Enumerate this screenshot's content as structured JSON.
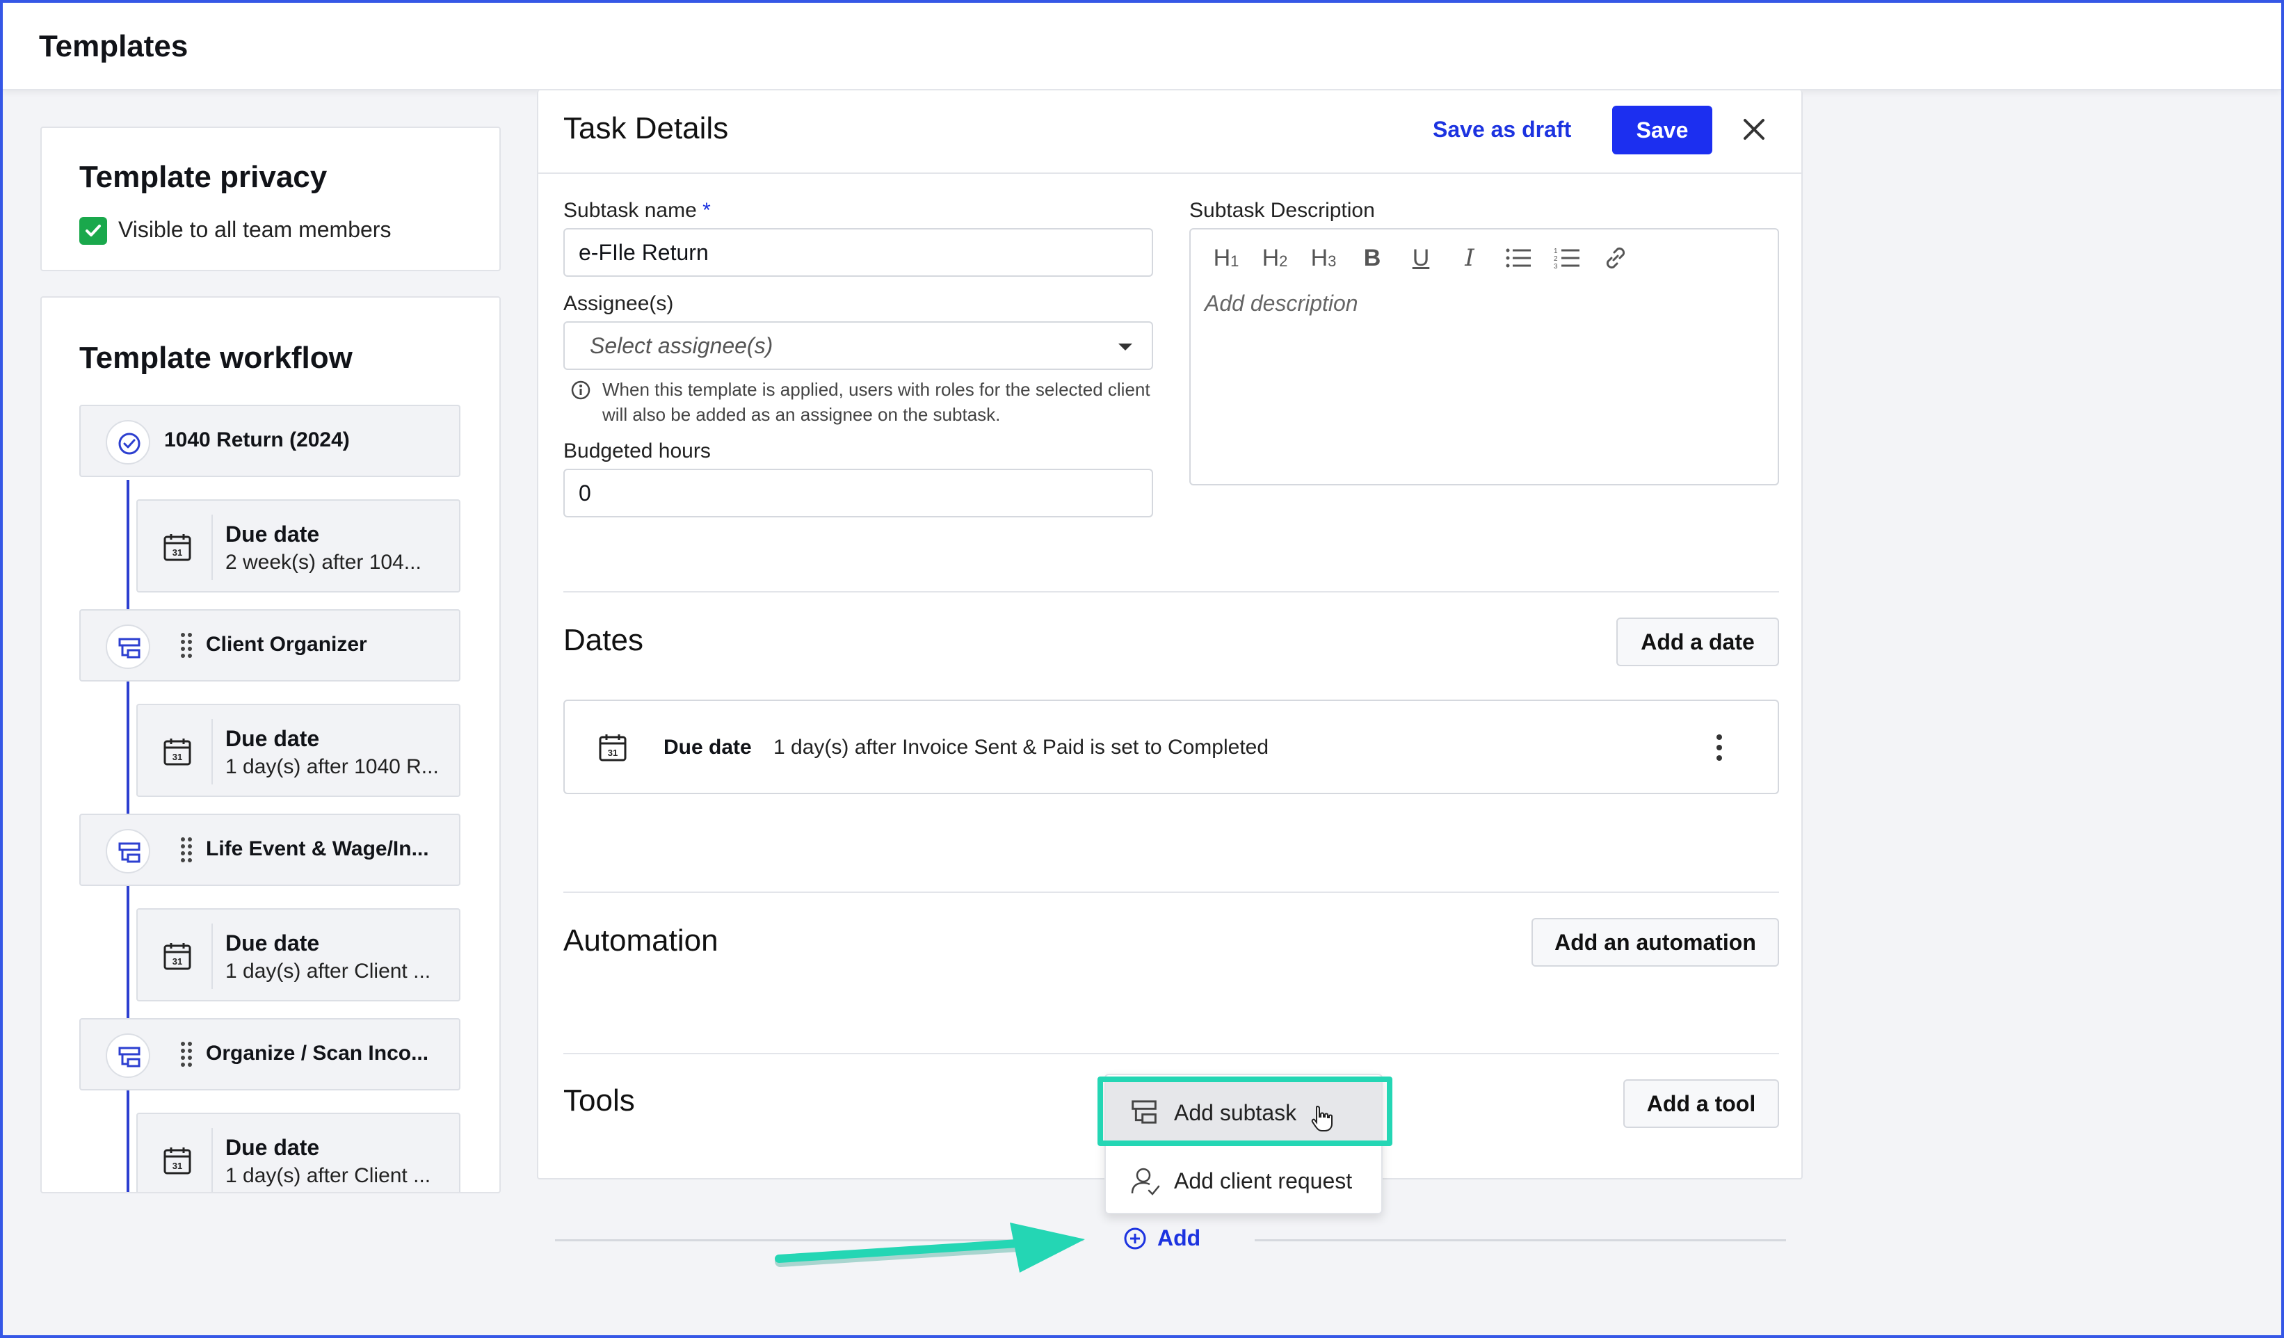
{
  "app": {
    "title": "Templates"
  },
  "privacy": {
    "heading": "Template privacy",
    "checkbox_label": "Visible to all team members",
    "checked": true
  },
  "workflow": {
    "heading": "Template workflow",
    "items": [
      {
        "name": "1040 Return (2024)",
        "icon": "check-circle-icon",
        "due_label": "Due date",
        "due_value": "2 week(s) after 104..."
      },
      {
        "name": "Client Organizer",
        "icon": "subtask-icon",
        "due_label": "Due date",
        "due_value": "1 day(s) after 1040 R..."
      },
      {
        "name": "Life Event & Wage/In...",
        "icon": "subtask-icon",
        "due_label": "Due date",
        "due_value": "1 day(s) after Client ..."
      },
      {
        "name": "Organize / Scan Inco...",
        "icon": "subtask-icon",
        "due_label": "Due date",
        "due_value": "1 day(s) after Client ..."
      }
    ]
  },
  "task": {
    "header": "Task Details",
    "save_draft_label": "Save as draft",
    "save_label": "Save",
    "subtask_name_label": "Subtask name",
    "required_mark": "*",
    "subtask_name_value": "e-FIle Return",
    "assignees_label": "Assignee(s)",
    "assignees_placeholder": "Select assignee(s)",
    "assignees_hint": "When this template is applied, users with roles for the selected client will also be added as an assignee on the subtask.",
    "budget_label": "Budgeted hours",
    "budget_value": "0",
    "description_label": "Subtask Description",
    "description_placeholder": "Add description",
    "rte_tools": [
      "H1",
      "H2",
      "H3",
      "B",
      "U",
      "I",
      "bullet-list",
      "numbered-list",
      "link"
    ]
  },
  "dates": {
    "title": "Dates",
    "add_label": "Add a date",
    "row_label": "Due date",
    "row_value": "1 day(s) after Invoice Sent & Paid is set to Completed"
  },
  "automation": {
    "title": "Automation",
    "add_label": "Add an automation"
  },
  "tools": {
    "title": "Tools",
    "add_label": "Add a tool"
  },
  "add_menu": {
    "items": [
      {
        "label": "Add subtask",
        "icon": "subtask-icon",
        "highlighted": true
      },
      {
        "label": "Add client request",
        "icon": "client-request-icon"
      }
    ],
    "add_label": "Add"
  },
  "colors": {
    "accent": "#1c33e0",
    "primary_button": "#1c2ff0",
    "highlight": "#24d6b4",
    "checkbox": "#1aa84c"
  }
}
